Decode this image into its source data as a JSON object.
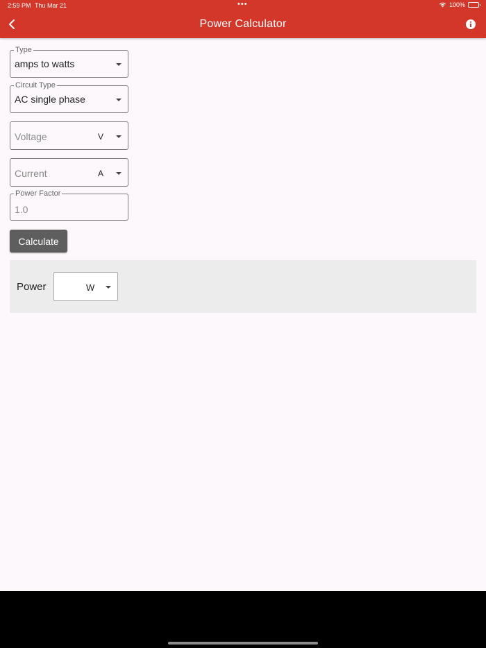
{
  "status_bar": {
    "time": "2:59 PM",
    "date": "Thu Mar 21",
    "dots": "•••",
    "battery": "100%"
  },
  "header": {
    "title": "Power Calculator",
    "back_icon": "chevron-left-icon",
    "info_icon": "info-icon"
  },
  "form": {
    "type": {
      "label": "Type",
      "value": "amps to watts"
    },
    "circuit_type": {
      "label": "Circuit Type",
      "value": "AC single phase"
    },
    "voltage": {
      "placeholder": "Voltage",
      "unit": "V"
    },
    "current": {
      "placeholder": "Current",
      "unit": "A"
    },
    "power_factor": {
      "label": "Power Factor",
      "value": "1.0"
    },
    "calculate_label": "Calculate"
  },
  "result": {
    "label": "Power",
    "unit": "W"
  },
  "colors": {
    "header": "#d3372a",
    "button": "#5e5e5e",
    "background": "#fdf8fc",
    "result_panel": "#ececec"
  }
}
